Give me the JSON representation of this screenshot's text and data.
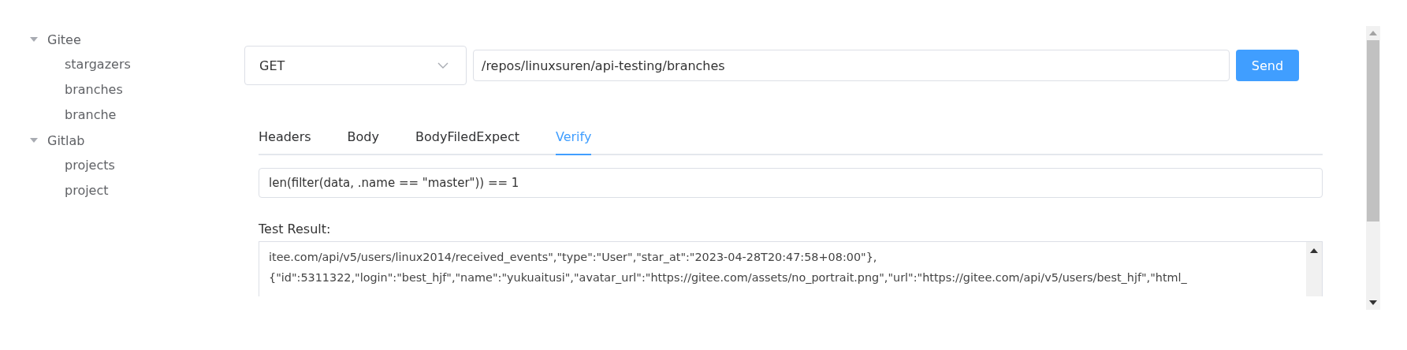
{
  "tree": [
    {
      "label": "Gitee",
      "expanded": true,
      "children": [
        {
          "label": "stargazers"
        },
        {
          "label": "branches"
        },
        {
          "label": "branche"
        }
      ]
    },
    {
      "label": "Gitlab",
      "expanded": true,
      "children": [
        {
          "label": "projects"
        },
        {
          "label": "project"
        }
      ]
    }
  ],
  "request": {
    "method": "GET",
    "url": "/repos/linuxsuren/api-testing/branches",
    "send": "Send"
  },
  "tabs": [
    {
      "label": "Headers",
      "selected": false
    },
    {
      "label": "Body",
      "selected": false
    },
    {
      "label": "BodyFiledExpect",
      "selected": false
    },
    {
      "label": "Verify",
      "selected": true
    }
  ],
  "verify": {
    "value": "len(filter(data, .name == \"master\")) == 1"
  },
  "result": {
    "label": "Test Result:",
    "lines": [
      "itee.com/api/v5/users/linux2014/received_events\",\"type\":\"User\",\"star_at\":\"2023-04-28T20:47:58+08:00\"},",
      "{\"id\":5311322,\"login\":\"best_hjf\",\"name\":\"yukuaitusi\",\"avatar_url\":\"https://gitee.com/assets/no_portrait.png\",\"url\":\"https://gitee.com/api/v5/users/best_hjf\",\"html_"
    ]
  }
}
